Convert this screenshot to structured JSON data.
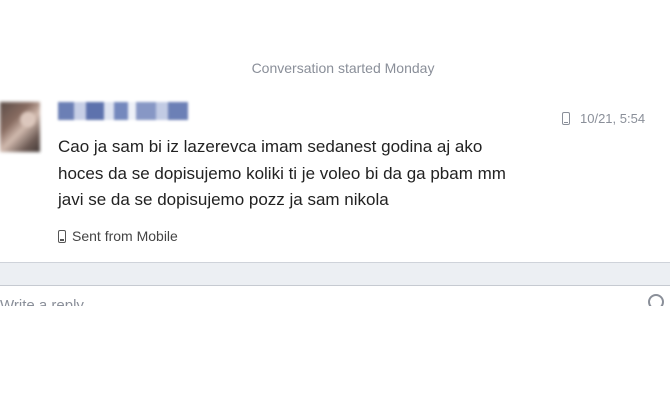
{
  "conversation": {
    "started_label": "Conversation started Monday"
  },
  "message": {
    "sender_name_redacted": true,
    "timestamp": "10/21, 5:54",
    "lines": [
      "Cao ja sam bi iz lazerevca imam sedanest godina aj ako",
      "hoces da se dopisujemo koliki ti je voleo bi da ga pbam mm",
      "javi se da se dopisujemo pozz ja sam nikola"
    ],
    "sent_from": "Sent from Mobile"
  },
  "reply": {
    "placeholder": "Write a reply..."
  },
  "icons": {
    "mobile": "phone-icon",
    "attach": "camera-icon"
  },
  "colors": {
    "meta_text": "#8a8f99",
    "body_text": "#222222",
    "divider_bg": "#eceff3"
  }
}
